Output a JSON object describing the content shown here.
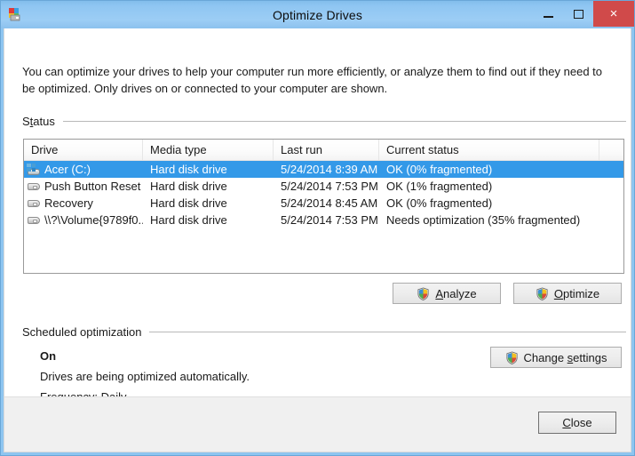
{
  "window": {
    "title": "Optimize Drives",
    "icon": "defrag-drive-icon",
    "controls": {
      "minimize": "minimize-icon",
      "maximize": "maximize-icon",
      "close": "×"
    }
  },
  "intro": {
    "text": "You can optimize your drives to help your computer run more efficiently, or analyze them to find out if they need to be optimized. Only drives on or connected to your computer are shown."
  },
  "status_section": {
    "label_pre": "S",
    "label_accel": "t",
    "label_post": "atus",
    "columns": [
      {
        "key": "drive",
        "label": "Drive"
      },
      {
        "key": "media",
        "label": "Media type"
      },
      {
        "key": "last_run",
        "label": "Last run"
      },
      {
        "key": "current_status",
        "label": "Current status"
      },
      {
        "key": "extra",
        "label": ""
      }
    ],
    "rows": [
      {
        "drive": "Acer (C:)",
        "media": "Hard disk drive",
        "last_run": "5/24/2014 8:39 AM",
        "current_status": "OK (0% fragmented)",
        "icon": "system-drive-icon",
        "selected": true
      },
      {
        "drive": "Push Button Reset",
        "media": "Hard disk drive",
        "last_run": "5/24/2014 7:53 PM",
        "current_status": "OK (1% fragmented)",
        "icon": "drive-icon",
        "selected": false
      },
      {
        "drive": "Recovery",
        "media": "Hard disk drive",
        "last_run": "5/24/2014 8:45 AM",
        "current_status": "OK (0% fragmented)",
        "icon": "drive-icon",
        "selected": false
      },
      {
        "drive": "\\\\?\\Volume{9789f0...",
        "media": "Hard disk drive",
        "last_run": "5/24/2014 7:53 PM",
        "current_status": "Needs optimization (35% fragmented)",
        "icon": "drive-icon",
        "selected": false
      }
    ]
  },
  "action_buttons": {
    "analyze": {
      "pre": "",
      "accel": "A",
      "post": "nalyze",
      "shield": true
    },
    "optimize": {
      "pre": "",
      "accel": "O",
      "post": "ptimize",
      "shield": true
    }
  },
  "scheduled_section": {
    "label_pre": "Scheduled optimization",
    "state": "On",
    "description": "Drives are being optimized automatically.",
    "frequency": "Frequency: Daily",
    "change_button": {
      "pre": "Change ",
      "accel": "s",
      "post": "ettings",
      "shield": true
    }
  },
  "footer": {
    "close_button": {
      "pre": "",
      "accel": "C",
      "post": "lose"
    }
  },
  "colors": {
    "titlebar": "#8fc6f2",
    "close_button": "#d04a4a",
    "selection": "#3399e8",
    "footer": "#f0f0f0",
    "border": "#9a9a9a"
  }
}
